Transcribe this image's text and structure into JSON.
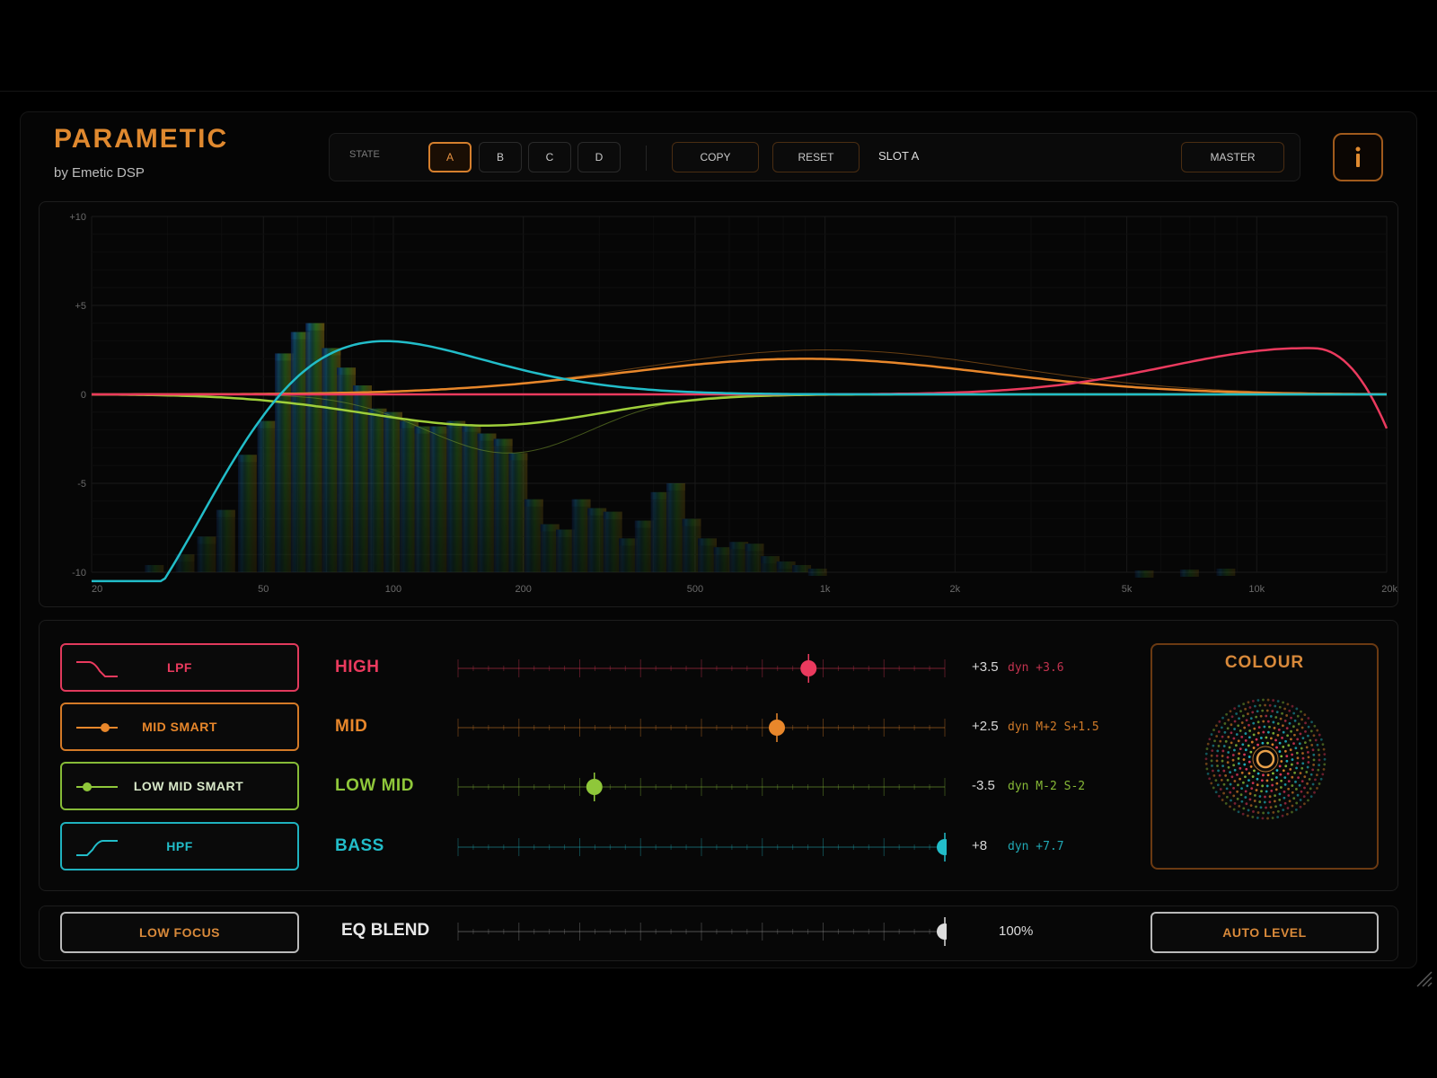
{
  "app": {
    "title": "PARAMETIC",
    "subtitle": "by Emetic DSP"
  },
  "toolbar": {
    "state_label": "STATE",
    "states": [
      "A",
      "B",
      "C",
      "D"
    ],
    "active_state": "A",
    "copy_label": "COPY",
    "reset_label": "RESET",
    "slot_label": "SLOT A",
    "master_label": "MASTER",
    "info_label": "i"
  },
  "analyzer": {
    "y_ticks": [
      "+10",
      "+5",
      "0",
      "-5",
      "-10"
    ],
    "x_ticks": [
      "20",
      "50",
      "100",
      "200",
      "500",
      "1k",
      "2k",
      "5k",
      "10k",
      "20k"
    ]
  },
  "bands": [
    {
      "button": "LPF",
      "label": "HIGH",
      "value": "+3.5",
      "dyn": "dyn +3.6",
      "color": "#ea3a5e",
      "position": 0.72
    },
    {
      "button": "MID SMART",
      "label": "MID",
      "value": "+2.5",
      "dyn": "dyn M+2 S+1.5",
      "color": "#e8872b",
      "position": 0.655
    },
    {
      "button": "LOW MID SMART",
      "label": "LOW MID",
      "value": "-3.5",
      "dyn": "dyn M-2 S-2",
      "color": "#8fc73a",
      "position": 0.28
    },
    {
      "button": "HPF",
      "label": "BASS",
      "value": "+8",
      "dyn": "dyn +7.7",
      "color": "#22bdc9",
      "position": 1.0
    }
  ],
  "colour": {
    "title": "COLOUR"
  },
  "bottom": {
    "low_focus_label": "LOW FOCUS",
    "eq_blend_label": "EQ BLEND",
    "eq_blend_value": "100%",
    "eq_blend_position": 1.0,
    "auto_level_label": "AUTO LEVEL"
  }
}
